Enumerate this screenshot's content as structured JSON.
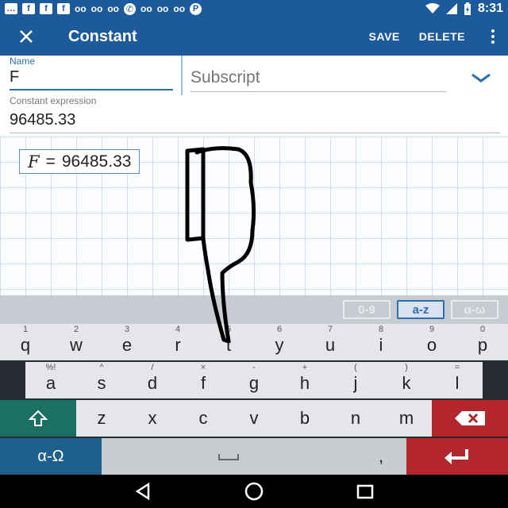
{
  "status_bar": {
    "time": "8:31",
    "notification_icons": [
      "message-icon",
      "facebook-icon",
      "facebook-icon",
      "facebook-icon",
      "voicemail-icon",
      "voicemail-icon",
      "voicemail-icon",
      "viber-icon",
      "voicemail-icon",
      "voicemail-icon",
      "voicemail-icon",
      "pinterest-icon"
    ],
    "system_icons": [
      "wifi-icon",
      "signal-icon",
      "battery-charging-icon"
    ]
  },
  "app_bar": {
    "title": "Constant",
    "save_label": "SAVE",
    "delete_label": "DELETE",
    "close_icon": "close-icon",
    "more_icon": "more-vert-icon"
  },
  "form": {
    "name_label": "Name",
    "name_value": "F",
    "subscript_placeholder": "Subscript",
    "expression_label": "Constant expression",
    "expression_value": "96485.33"
  },
  "preview": {
    "variable": "F",
    "equals": "=",
    "value": "96485.33"
  },
  "keyboard": {
    "tabs": [
      {
        "label": "0-9",
        "active": false
      },
      {
        "label": "a-z",
        "active": true
      },
      {
        "label": "α-ω",
        "active": false
      }
    ],
    "row1": [
      {
        "key": "q",
        "hint": "1"
      },
      {
        "key": "w",
        "hint": "2"
      },
      {
        "key": "e",
        "hint": "3"
      },
      {
        "key": "r",
        "hint": "4"
      },
      {
        "key": "t",
        "hint": "5"
      },
      {
        "key": "y",
        "hint": "6"
      },
      {
        "key": "u",
        "hint": "7"
      },
      {
        "key": "i",
        "hint": "8"
      },
      {
        "key": "o",
        "hint": "9"
      },
      {
        "key": "p",
        "hint": "0"
      }
    ],
    "row2": [
      {
        "key": "a",
        "hint": "%!"
      },
      {
        "key": "s",
        "hint": "^"
      },
      {
        "key": "d",
        "hint": "/"
      },
      {
        "key": "f",
        "hint": "×"
      },
      {
        "key": "g",
        "hint": "-"
      },
      {
        "key": "h",
        "hint": "+"
      },
      {
        "key": "j",
        "hint": "("
      },
      {
        "key": "k",
        "hint": ")"
      },
      {
        "key": "l",
        "hint": "="
      }
    ],
    "row3": [
      "z",
      "x",
      "c",
      "v",
      "b",
      "n",
      "m"
    ],
    "alpha_label": "α-Ω",
    "comma": ","
  },
  "colors": {
    "primary": "#1d5a9c",
    "accent": "#2a6fb5",
    "shift_key": "#1b6f63",
    "alpha_key": "#1f5f8b",
    "danger_key": "#b3262b"
  }
}
